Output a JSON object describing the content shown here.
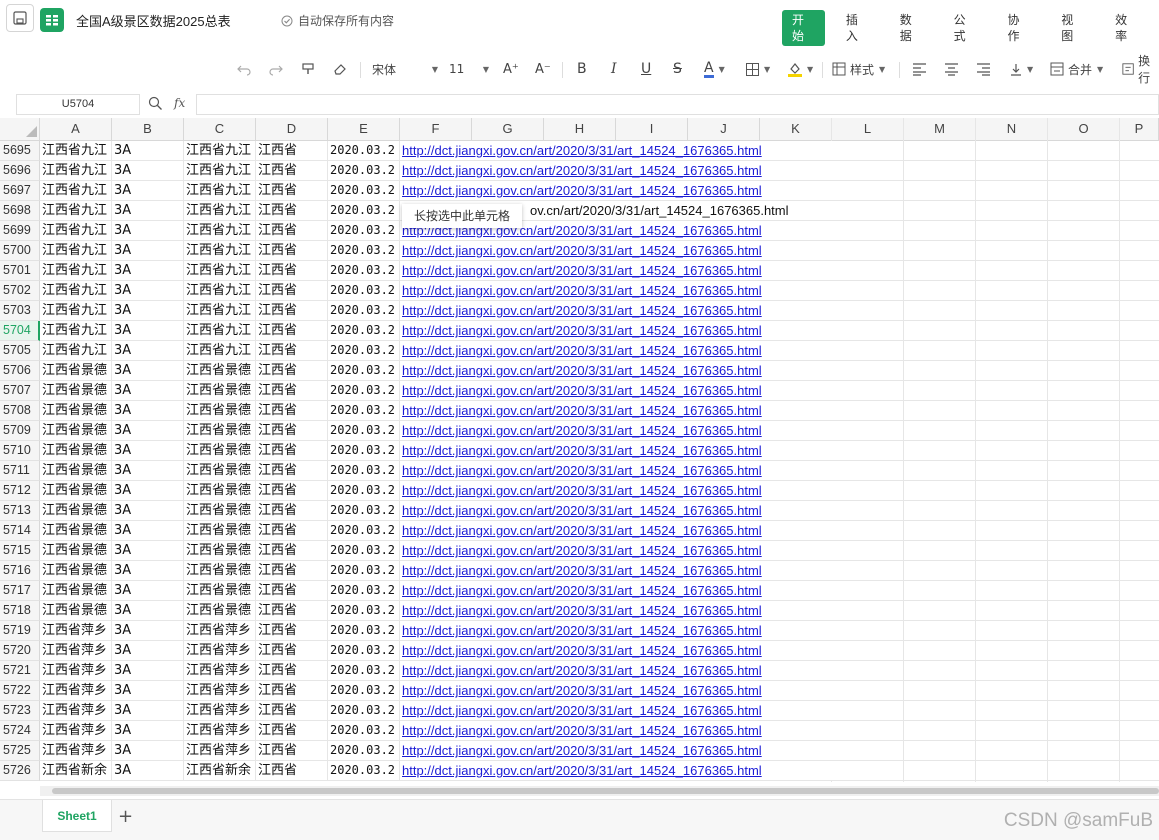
{
  "app": {
    "title": "全国A级景区数据2025总表",
    "autosave": "自动保存所有内容"
  },
  "menu": [
    "开始",
    "插入",
    "数据",
    "公式",
    "协作",
    "视图",
    "效率"
  ],
  "toolbar": {
    "font_name": "宋体",
    "font_size": "11",
    "style_label": "样式",
    "merge_label": "合并",
    "wrap_label": "换行",
    "accent": "#1fa462"
  },
  "formula_bar": {
    "cell_ref": "U5704",
    "fx": "fx",
    "content": ""
  },
  "columns": [
    "A",
    "B",
    "C",
    "D",
    "E",
    "F",
    "G",
    "H",
    "I",
    "J",
    "K",
    "L",
    "M",
    "N",
    "O",
    "P"
  ],
  "tooltip": "长按选中此单元格",
  "tooltip_row_tail": "ov.cn/art/2020/3/31/art_14524_1676365.html",
  "rows": [
    {
      "num": "5695",
      "a": "江西省九江",
      "b": "3A",
      "c": "江西省九江",
      "d": "江西省",
      "e": "2020.03.2",
      "url": "http://dct.jiangxi.gov.cn/art/2020/3/31/art_14524_1676365.html"
    },
    {
      "num": "5696",
      "a": "江西省九江",
      "b": "3A",
      "c": "江西省九江",
      "d": "江西省",
      "e": "2020.03.2",
      "url": "http://dct.jiangxi.gov.cn/art/2020/3/31/art_14524_1676365.html"
    },
    {
      "num": "5697",
      "a": "江西省九江",
      "b": "3A",
      "c": "江西省九江",
      "d": "江西省",
      "e": "2020.03.2",
      "url": "http://dct.jiangxi.gov.cn/art/2020/3/31/art_14524_1676365.html"
    },
    {
      "num": "5698",
      "a": "江西省九江",
      "b": "3A",
      "c": "江西省九江",
      "d": "江西省",
      "e": "2020.03.2",
      "url": ""
    },
    {
      "num": "5699",
      "a": "江西省九江",
      "b": "3A",
      "c": "江西省九江",
      "d": "江西省",
      "e": "2020.03.2",
      "url": "http://dct.jiangxi.gov.cn/art/2020/3/31/art_14524_1676365.html"
    },
    {
      "num": "5700",
      "a": "江西省九江",
      "b": "3A",
      "c": "江西省九江",
      "d": "江西省",
      "e": "2020.03.2",
      "url": "http://dct.jiangxi.gov.cn/art/2020/3/31/art_14524_1676365.html"
    },
    {
      "num": "5701",
      "a": "江西省九江",
      "b": "3A",
      "c": "江西省九江",
      "d": "江西省",
      "e": "2020.03.2",
      "url": "http://dct.jiangxi.gov.cn/art/2020/3/31/art_14524_1676365.html"
    },
    {
      "num": "5702",
      "a": "江西省九江",
      "b": "3A",
      "c": "江西省九江",
      "d": "江西省",
      "e": "2020.03.2",
      "url": "http://dct.jiangxi.gov.cn/art/2020/3/31/art_14524_1676365.html"
    },
    {
      "num": "5703",
      "a": "江西省九江",
      "b": "3A",
      "c": "江西省九江",
      "d": "江西省",
      "e": "2020.03.2",
      "url": "http://dct.jiangxi.gov.cn/art/2020/3/31/art_14524_1676365.html"
    },
    {
      "num": "5704",
      "a": "江西省九江",
      "b": "3A",
      "c": "江西省九江",
      "d": "江西省",
      "e": "2020.03.2",
      "url": "http://dct.jiangxi.gov.cn/art/2020/3/31/art_14524_1676365.html"
    },
    {
      "num": "5705",
      "a": "江西省九江",
      "b": "3A",
      "c": "江西省九江",
      "d": "江西省",
      "e": "2020.03.2",
      "url": "http://dct.jiangxi.gov.cn/art/2020/3/31/art_14524_1676365.html"
    },
    {
      "num": "5706",
      "a": "江西省景德",
      "b": "3A",
      "c": "江西省景德",
      "d": "江西省",
      "e": "2020.03.2",
      "url": "http://dct.jiangxi.gov.cn/art/2020/3/31/art_14524_1676365.html"
    },
    {
      "num": "5707",
      "a": "江西省景德",
      "b": "3A",
      "c": "江西省景德",
      "d": "江西省",
      "e": "2020.03.2",
      "url": "http://dct.jiangxi.gov.cn/art/2020/3/31/art_14524_1676365.html"
    },
    {
      "num": "5708",
      "a": "江西省景德",
      "b": "3A",
      "c": "江西省景德",
      "d": "江西省",
      "e": "2020.03.2",
      "url": "http://dct.jiangxi.gov.cn/art/2020/3/31/art_14524_1676365.html"
    },
    {
      "num": "5709",
      "a": "江西省景德",
      "b": "3A",
      "c": "江西省景德",
      "d": "江西省",
      "e": "2020.03.2",
      "url": "http://dct.jiangxi.gov.cn/art/2020/3/31/art_14524_1676365.html"
    },
    {
      "num": "5710",
      "a": "江西省景德",
      "b": "3A",
      "c": "江西省景德",
      "d": "江西省",
      "e": "2020.03.2",
      "url": "http://dct.jiangxi.gov.cn/art/2020/3/31/art_14524_1676365.html"
    },
    {
      "num": "5711",
      "a": "江西省景德",
      "b": "3A",
      "c": "江西省景德",
      "d": "江西省",
      "e": "2020.03.2",
      "url": "http://dct.jiangxi.gov.cn/art/2020/3/31/art_14524_1676365.html"
    },
    {
      "num": "5712",
      "a": "江西省景德",
      "b": "3A",
      "c": "江西省景德",
      "d": "江西省",
      "e": "2020.03.2",
      "url": "http://dct.jiangxi.gov.cn/art/2020/3/31/art_14524_1676365.html"
    },
    {
      "num": "5713",
      "a": "江西省景德",
      "b": "3A",
      "c": "江西省景德",
      "d": "江西省",
      "e": "2020.03.2",
      "url": "http://dct.jiangxi.gov.cn/art/2020/3/31/art_14524_1676365.html"
    },
    {
      "num": "5714",
      "a": "江西省景德",
      "b": "3A",
      "c": "江西省景德",
      "d": "江西省",
      "e": "2020.03.2",
      "url": "http://dct.jiangxi.gov.cn/art/2020/3/31/art_14524_1676365.html"
    },
    {
      "num": "5715",
      "a": "江西省景德",
      "b": "3A",
      "c": "江西省景德",
      "d": "江西省",
      "e": "2020.03.2",
      "url": "http://dct.jiangxi.gov.cn/art/2020/3/31/art_14524_1676365.html"
    },
    {
      "num": "5716",
      "a": "江西省景德",
      "b": "3A",
      "c": "江西省景德",
      "d": "江西省",
      "e": "2020.03.2",
      "url": "http://dct.jiangxi.gov.cn/art/2020/3/31/art_14524_1676365.html"
    },
    {
      "num": "5717",
      "a": "江西省景德",
      "b": "3A",
      "c": "江西省景德",
      "d": "江西省",
      "e": "2020.03.2",
      "url": "http://dct.jiangxi.gov.cn/art/2020/3/31/art_14524_1676365.html"
    },
    {
      "num": "5718",
      "a": "江西省景德",
      "b": "3A",
      "c": "江西省景德",
      "d": "江西省",
      "e": "2020.03.2",
      "url": "http://dct.jiangxi.gov.cn/art/2020/3/31/art_14524_1676365.html"
    },
    {
      "num": "5719",
      "a": "江西省萍乡",
      "b": "3A",
      "c": "江西省萍乡",
      "d": "江西省",
      "e": "2020.03.2",
      "url": "http://dct.jiangxi.gov.cn/art/2020/3/31/art_14524_1676365.html"
    },
    {
      "num": "5720",
      "a": "江西省萍乡",
      "b": "3A",
      "c": "江西省萍乡",
      "d": "江西省",
      "e": "2020.03.2",
      "url": "http://dct.jiangxi.gov.cn/art/2020/3/31/art_14524_1676365.html"
    },
    {
      "num": "5721",
      "a": "江西省萍乡",
      "b": "3A",
      "c": "江西省萍乡",
      "d": "江西省",
      "e": "2020.03.2",
      "url": "http://dct.jiangxi.gov.cn/art/2020/3/31/art_14524_1676365.html"
    },
    {
      "num": "5722",
      "a": "江西省萍乡",
      "b": "3A",
      "c": "江西省萍乡",
      "d": "江西省",
      "e": "2020.03.2",
      "url": "http://dct.jiangxi.gov.cn/art/2020/3/31/art_14524_1676365.html"
    },
    {
      "num": "5723",
      "a": "江西省萍乡",
      "b": "3A",
      "c": "江西省萍乡",
      "d": "江西省",
      "e": "2020.03.2",
      "url": "http://dct.jiangxi.gov.cn/art/2020/3/31/art_14524_1676365.html"
    },
    {
      "num": "5724",
      "a": "江西省萍乡",
      "b": "3A",
      "c": "江西省萍乡",
      "d": "江西省",
      "e": "2020.03.2",
      "url": "http://dct.jiangxi.gov.cn/art/2020/3/31/art_14524_1676365.html"
    },
    {
      "num": "5725",
      "a": "江西省萍乡",
      "b": "3A",
      "c": "江西省萍乡",
      "d": "江西省",
      "e": "2020.03.2",
      "url": "http://dct.jiangxi.gov.cn/art/2020/3/31/art_14524_1676365.html"
    },
    {
      "num": "5726",
      "a": "江西省新余",
      "b": "3A",
      "c": "江西省新余",
      "d": "江西省",
      "e": "2020.03.2",
      "url": "http://dct.jiangxi.gov.cn/art/2020/3/31/art_14524_1676365.html"
    }
  ],
  "selected_row": "5704",
  "sheets": [
    "Sheet1"
  ],
  "watermark": "CSDN @samFuB"
}
